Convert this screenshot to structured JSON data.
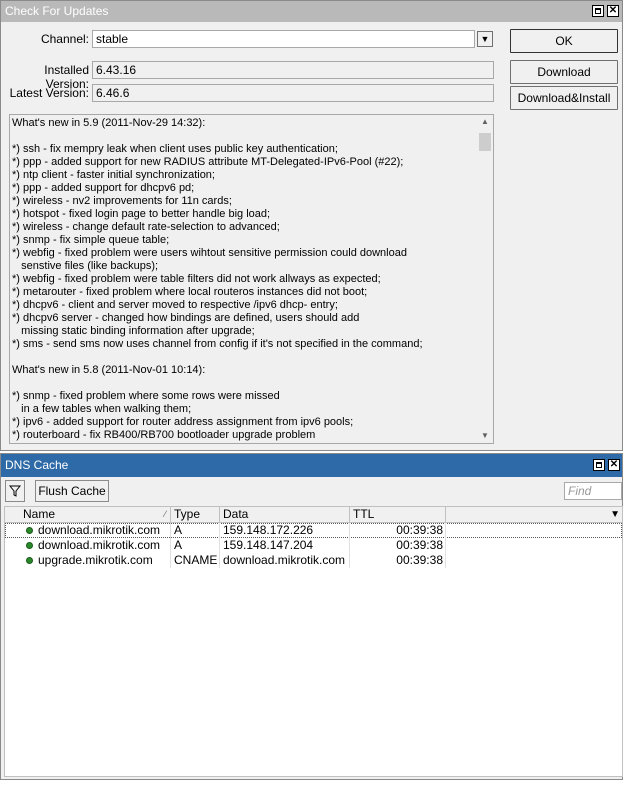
{
  "updates": {
    "title": "Check For Updates",
    "channel_label": "Channel:",
    "channel_value": "stable",
    "installed_label": "Installed Version:",
    "installed_value": "6.43.16",
    "latest_label": "Latest Version:",
    "latest_value": "6.46.6",
    "ok_label": "OK",
    "download_label": "Download",
    "download_install_label": "Download&Install",
    "whats_new": [
      "What's new in 5.9 (2011-Nov-29 14:32):",
      "",
      "*) ssh - fix mempry leak when client uses public key authentication;",
      "*) ppp - added support for new RADIUS attribute MT-Delegated-IPv6-Pool (#22);",
      "*) ntp client - faster initial synchronization;",
      "*) ppp - added support for dhcpv6 pd;",
      "*) wireless - nv2 improvements for 11n cards;",
      "*) hotspot - fixed login page to better handle big load;",
      "*) wireless - change default rate-selection to advanced;",
      "*) snmp - fix simple queue table;",
      "*) webfig - fixed problem were users wihtout sensitive permission could download",
      "   senstive files (like backups);",
      "*) webfig - fixed problem were table filters did not work allways as expected;",
      "*) metarouter - fixed problem where local routeros instances did not boot;",
      "*) dhcpv6 - client and server moved to respective /ipv6 dhcp- entry;",
      "*) dhcpv6 server - changed how bindings are defined, users should add",
      "   missing static binding information after upgrade;",
      "*) sms - send sms now uses channel from config if it's not specified in the command;",
      "",
      "What's new in 5.8 (2011-Nov-01 10:14):",
      "",
      "*) snmp - fixed problem where some rows were missed",
      "   in a few tables when walking them;",
      "*) ipv6 - added support for router address assignment from ipv6 pools;",
      "*) routerboard - fix RB400/RB700 bootloader upgrade problem"
    ]
  },
  "dns": {
    "title": "DNS Cache",
    "flush_label": "Flush Cache",
    "find_placeholder": "Find",
    "columns": [
      "Name",
      "Type",
      "Data",
      "TTL"
    ],
    "rows": [
      {
        "name": "download.mikrotik.com",
        "type": "A",
        "data": "159.148.172.226",
        "ttl": "00:39:38"
      },
      {
        "name": "download.mikrotik.com",
        "type": "A",
        "data": "159.148.147.204",
        "ttl": "00:39:38"
      },
      {
        "name": "upgrade.mikrotik.com",
        "type": "CNAME",
        "data": "download.mikrotik.com",
        "ttl": "00:39:38"
      }
    ]
  }
}
